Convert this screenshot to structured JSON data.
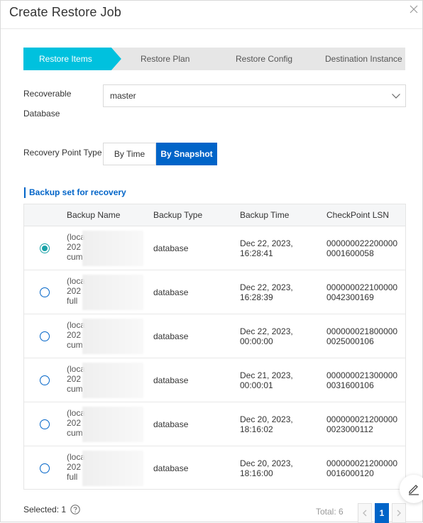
{
  "dialog": {
    "title": "Create Restore Job"
  },
  "steps": [
    "Restore Items",
    "Restore Plan",
    "Restore Config",
    "Destination Instance"
  ],
  "recoverable_database": {
    "label_line1": "Recoverable",
    "label_line2": "Database",
    "value": "master"
  },
  "recovery_point": {
    "label": "Recovery Point Type",
    "options": [
      "By Time",
      "By Snapshot"
    ],
    "selected": "By Snapshot"
  },
  "section_title": "Backup set for recovery",
  "table": {
    "columns": [
      "Backup Name",
      "Backup Type",
      "Backup Time",
      "CheckPoint LSN"
    ],
    "rows": [
      {
        "name_l1": "(loca",
        "name_l2": "202",
        "name_l3": "cum",
        "type": "database",
        "time_l1": "Dec 22, 2023,",
        "time_l2": "16:28:41",
        "lsn": "0000000222000000001600058",
        "selected": true
      },
      {
        "name_l1": "(loca",
        "name_l2": "202",
        "name_l3": "full",
        "type": "database",
        "time_l1": "Dec 22, 2023,",
        "time_l2": "16:28:39",
        "lsn": "0000000221000000042300169",
        "selected": false
      },
      {
        "name_l1": "(loca",
        "name_l2": "202",
        "name_l3": "cum",
        "type": "database",
        "time_l1": "Dec 22, 2023,",
        "time_l2": "00:00:00",
        "lsn": "0000000218000000025000106",
        "selected": false
      },
      {
        "name_l1": "(loca",
        "name_l2": "202",
        "name_l3": "cum",
        "type": "database",
        "time_l1": "Dec 21, 2023,",
        "time_l2": "00:00:01",
        "lsn": "0000000213000000031600106",
        "selected": false
      },
      {
        "name_l1": "(loca",
        "name_l2": "202",
        "name_l3": "cum",
        "type": "database",
        "time_l1": "Dec 20, 2023,",
        "time_l2": "18:16:02",
        "lsn": "0000000212000000023000112",
        "selected": false
      },
      {
        "name_l1": "(loca",
        "name_l2": "202",
        "name_l3": "full",
        "type": "database",
        "time_l1": "Dec 20, 2023,",
        "time_l2": "18:16:00",
        "lsn": "0000000212000000016000120",
        "selected": false
      }
    ]
  },
  "footer": {
    "selected_text": "Selected: 1",
    "total_text": "Total: 6",
    "current_page": "1"
  },
  "colors": {
    "accent": "#0064c8",
    "step_active": "#00c1de",
    "step_inactive": "#e6e6e6",
    "radio_selected": "#1aa2a8"
  }
}
